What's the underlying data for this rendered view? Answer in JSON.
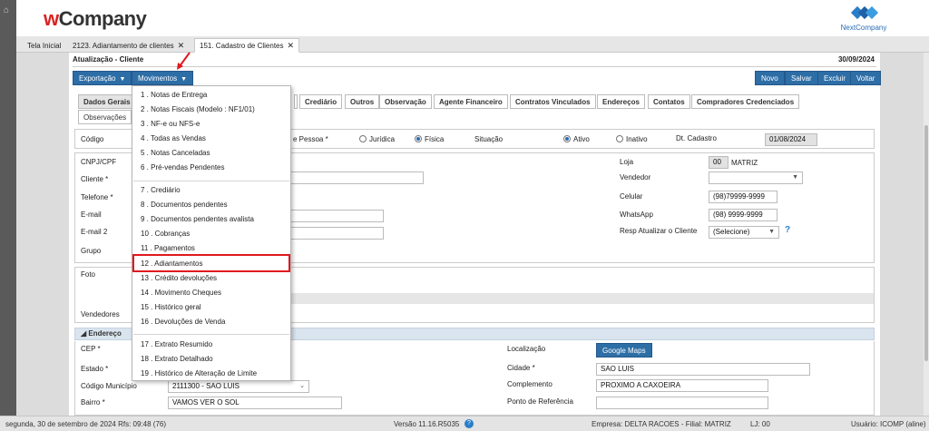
{
  "header": {
    "logo_w": "w",
    "logo_rest": "Company",
    "brand2": "NextCompany"
  },
  "page_tabs": [
    {
      "label": "Tela Inicial",
      "closable": false
    },
    {
      "label": "2123. Adiantamento de clientes",
      "closable": true
    },
    {
      "label": "151. Cadastro de Clientes",
      "closable": true
    }
  ],
  "close_glyph": "✕",
  "form": {
    "title": "Atualização - Cliente",
    "date": "30/09/2024"
  },
  "toolbar": {
    "exportacao": "Exportação",
    "movimentos": "Movimentos",
    "novo": "Novo",
    "salvar": "Salvar",
    "excluir": "Excluir",
    "voltar": "Voltar"
  },
  "form_tabs": {
    "dados_gerais": "Dados Gerais",
    "credito": "Crediário",
    "outros": "Outros",
    "observacao": "Observação",
    "agente": "Agente Financeiro",
    "contratos": "Contratos Vinculados",
    "enderecos": "Endereços",
    "contatos": "Contatos",
    "compradores": "Compradores Credenciados",
    "observacoes": "Observações"
  },
  "ident": {
    "codigo": "Código",
    "tipo_pessoa": "e Pessoa *",
    "juridica": "Jurídica",
    "fisica": "Física",
    "situacao": "Situação",
    "ativo": "Ativo",
    "inativo": "Inativo",
    "dt_cadastro": "Dt. Cadastro",
    "dt_cadastro_value": "01/08/2024"
  },
  "dados": {
    "cnpj": "CNPJ/CPF",
    "cliente": "Cliente *",
    "telefone": "Telefone *",
    "email": "E-mail",
    "email2": "E-mail 2",
    "grupo": "Grupo",
    "loja": "Loja",
    "loja_code": "00",
    "loja_name": "MATRIZ",
    "vendedor": "Vendedor",
    "celular": "Celular",
    "celular_value": "(98)79999-9999",
    "whatsapp": "WhatsApp",
    "whatsapp_value": "(98) 9999-9999",
    "resp": "Resp Atualizar o Cliente",
    "resp_value": "(Selecione)",
    "help": "?"
  },
  "foto": {
    "foto": "Foto",
    "vendedores": "Vendedores"
  },
  "endereco": {
    "head": "◢ Endereço",
    "cep": "CEP *",
    "estado": "Estado *",
    "codigo_municipio": "Código Município",
    "codigo_municipio_value": "2111300 - SAO LUIS",
    "bairro": "Bairro *",
    "bairro_value": "VAMOS VER O SOL",
    "localizacao": "Localização",
    "google_maps": "Google Maps",
    "cidade": "Cidade *",
    "cidade_value": "SAO LUIS",
    "complemento": "Complemento",
    "complemento_value": "PROXIMO A CAXOEIRA",
    "ponto": "Ponto de Referência"
  },
  "menu": [
    "1 . Notas de Entrega",
    "2 . Notas Fiscais (Modelo : NF1/01)",
    "3 . NF-e ou NFS-e",
    "4 . Todas as Vendas",
    "5 . Notas Canceladas",
    "6 . Pré-vendas Pendentes",
    "7 . Crediário",
    "8 . Documentos pendentes",
    "9 . Documentos pendentes avalista",
    "10 . Cobranças",
    "11 . Pagamentos",
    "12 . Adiantamentos",
    "13 . Crédito devoluções",
    "14 . Movimento Cheques",
    "15 . Histórico geral",
    "16 . Devoluções de Venda",
    "17 . Extrato Resumido",
    "18 . Extrato Detalhado",
    "19 . Histórico de Alteração de Limite"
  ],
  "status": {
    "date": "segunda, 30 de setembro de 2024  Rfs: 09:48 (76)",
    "version": "Versão 11.16.R5035",
    "empresa": "Empresa: DELTA RACOES - Filial: MATRIZ",
    "lj": "LJ: 00",
    "usuario": "Usuário: ICOMP (aline)"
  },
  "colors": {
    "accent": "#2e6ea6",
    "highlight": "#e0191f"
  }
}
